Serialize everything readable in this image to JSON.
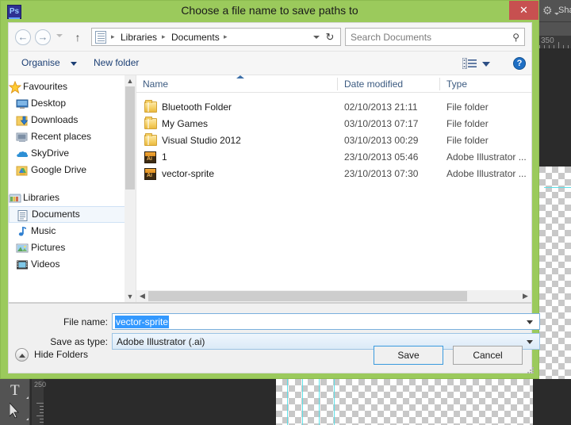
{
  "dialog": {
    "title": "Choose a file name to save paths to",
    "app_icon": "photoshop-icon",
    "app_icon_label": "Ps",
    "close_label": "✕"
  },
  "nav": {
    "back_icon": "←",
    "forward_icon": "→",
    "up_icon": "↑",
    "refresh_icon": "↻",
    "breadcrumbs": [
      "Libraries",
      "Documents"
    ],
    "separator": "▸"
  },
  "search": {
    "placeholder": "Search Documents",
    "icon": "⚲"
  },
  "toolbar": {
    "organise_label": "Organise",
    "new_folder_label": "New folder",
    "help_label": "?"
  },
  "sidebar": {
    "groups": [
      {
        "label": "Favourites",
        "icon": "star-icon",
        "items": [
          {
            "label": "Desktop",
            "icon": "desktop-icon"
          },
          {
            "label": "Downloads",
            "icon": "downloads-icon"
          },
          {
            "label": "Recent places",
            "icon": "recent-places-icon"
          },
          {
            "label": "SkyDrive",
            "icon": "skydrive-icon"
          },
          {
            "label": "Google Drive",
            "icon": "google-drive-icon"
          }
        ]
      },
      {
        "label": "Libraries",
        "icon": "libraries-icon",
        "items": [
          {
            "label": "Documents",
            "icon": "documents-icon",
            "selected": true
          },
          {
            "label": "Music",
            "icon": "music-icon"
          },
          {
            "label": "Pictures",
            "icon": "pictures-icon"
          },
          {
            "label": "Videos",
            "icon": "videos-icon"
          }
        ]
      }
    ]
  },
  "filelist": {
    "columns": [
      "Name",
      "Date modified",
      "Type"
    ],
    "sort_column": "Name",
    "sort_direction": "ascending",
    "rows": [
      {
        "name": "Bluetooth Folder",
        "date": "02/10/2013 21:11",
        "type": "File folder",
        "icon": "folder-icon"
      },
      {
        "name": "My Games",
        "date": "03/10/2013 07:17",
        "type": "File folder",
        "icon": "folder-icon"
      },
      {
        "name": "Visual Studio 2012",
        "date": "03/10/2013 00:29",
        "type": "File folder",
        "icon": "folder-icon"
      },
      {
        "name": "1",
        "date": "23/10/2013 05:46",
        "type": "Adobe Illustrator ...",
        "icon": "illustrator-file-icon"
      },
      {
        "name": "vector-sprite",
        "date": "23/10/2013 07:30",
        "type": "Adobe Illustrator ...",
        "icon": "illustrator-file-icon"
      }
    ]
  },
  "form": {
    "filename_label": "File name:",
    "filename_value": "vector-sprite",
    "savetype_label": "Save as type:",
    "savetype_value": "Adobe Illustrator (.ai)",
    "hide_folders_label": "Hide Folders",
    "save_label": "Save",
    "cancel_label": "Cancel"
  },
  "background": {
    "app": "photoshop",
    "options_label": "Sha",
    "ruler_h_value": "350",
    "ruler_v_value": "250",
    "tool_type_label": "T",
    "tool_path_selection": "path-selection-icon"
  },
  "colors": {
    "title_bar": "#9bca5c",
    "close_button": "#c75050",
    "selection_highlight": "#3399ff",
    "default_button_border": "#3a9ade",
    "link_text": "#1c3f74",
    "column_header_text": "#3b5a80"
  }
}
